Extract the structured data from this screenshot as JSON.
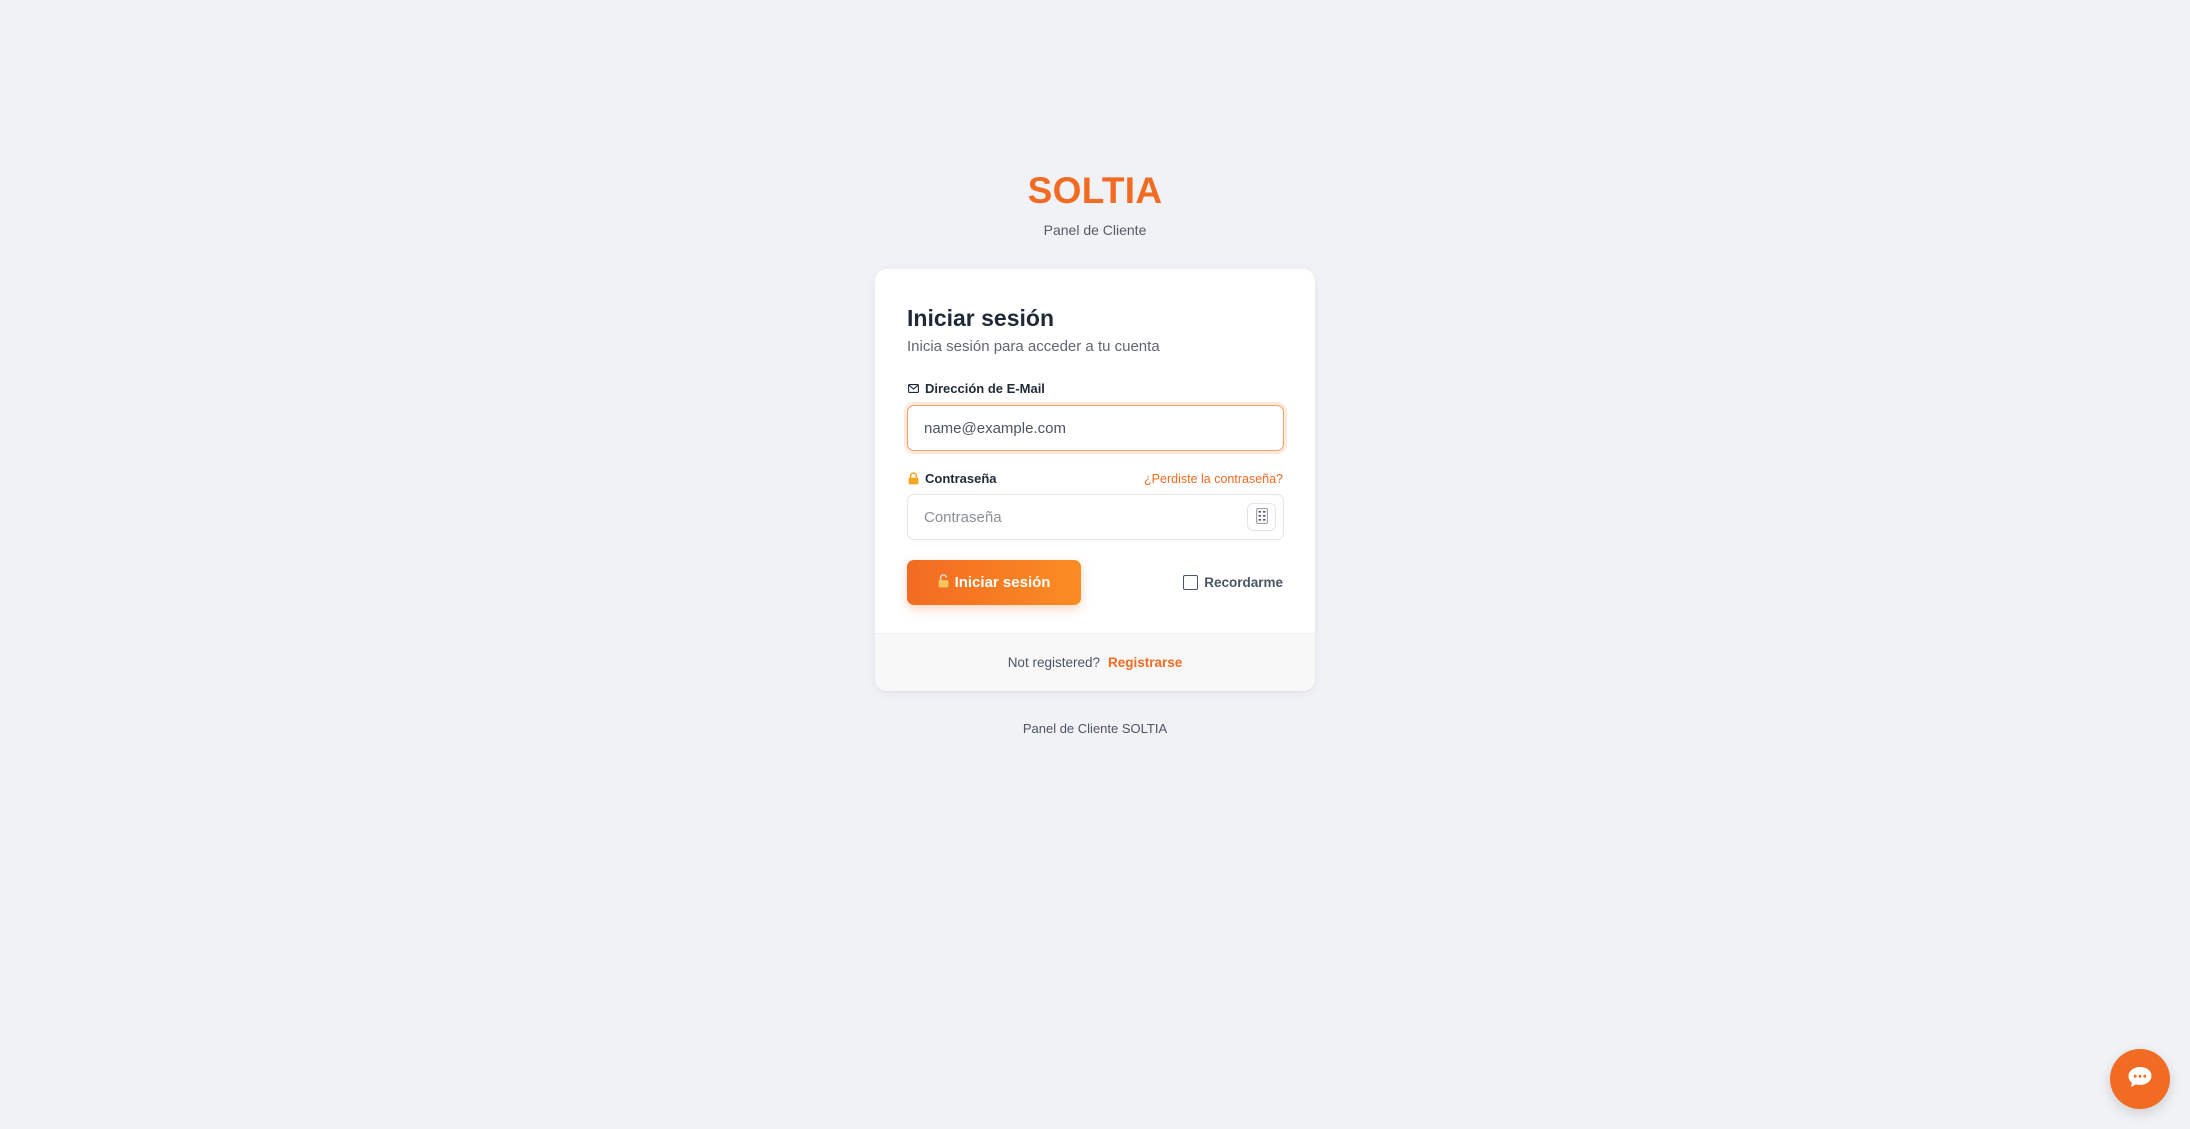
{
  "brand": {
    "logo": "SOLTIA",
    "subtitle": "Panel de Cliente"
  },
  "login": {
    "title": "Iniciar sesión",
    "subtitle": "Inicia sesión para acceder a tu cuenta",
    "email": {
      "icon": "envelope-icon",
      "label": "Dirección de E-Mail",
      "value": "",
      "placeholder": "name@example.com"
    },
    "password": {
      "icon": "lock-icon",
      "label": "Contraseña",
      "value": "",
      "placeholder": "Contraseña",
      "forgot_link": "¿Perdiste la contraseña?",
      "toggle_icon": "show-password-icon"
    },
    "submit": {
      "icon": "unlock-icon",
      "label": "Iniciar sesión"
    },
    "remember": {
      "label": "Recordarme",
      "checked": false
    }
  },
  "register": {
    "prompt": "Not registered?",
    "link": "Registrarse"
  },
  "footer": {
    "text": "Panel de Cliente SOLTIA"
  },
  "chat": {
    "icon": "chat-bubble-icon"
  },
  "colors": {
    "accent": "#f26b22",
    "accent_light": "#fb8c23",
    "background": "#f1f2f6",
    "card": "#ffffff"
  }
}
